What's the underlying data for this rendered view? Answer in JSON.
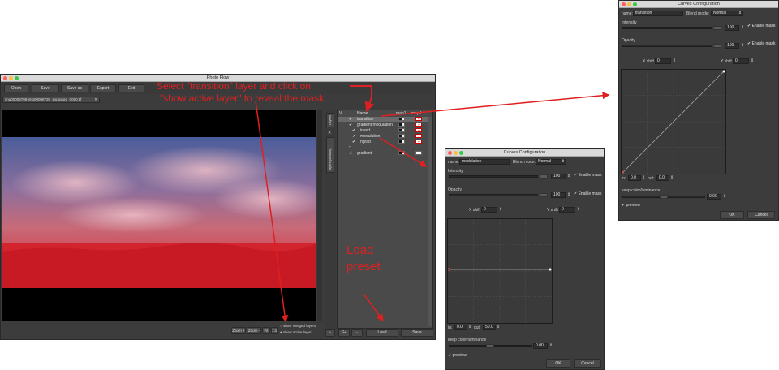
{
  "main_window": {
    "title": "Photo Flow",
    "toolbar": [
      "Open",
      "Save",
      "Save as",
      "Export",
      "Exit"
    ],
    "tab_filename": "img00008708-img00008720_exposure_0000.tif",
    "side_tabs": [
      "Layers",
      "layers (default)"
    ],
    "layers_header": {
      "v": "V",
      "name": "Name",
      "map1": "map1",
      "map2": "map2"
    },
    "layers": [
      "transition",
      "gradient modulation",
      "invert",
      "modulation",
      "hgrad",
      "",
      "gradient"
    ],
    "view_buttons": [
      "Zoom +",
      "Zoom -",
      "Fit",
      "1:1"
    ],
    "radio_options": [
      "show merged layers",
      "show active layer"
    ],
    "bottom_buttons": [
      "G+",
      "-",
      "Load",
      "Save"
    ]
  },
  "curves_small": {
    "title": "Curves Configuration",
    "name_label": "name:",
    "name_value": "modulation",
    "blend_label": "Blend mode:",
    "blend_value": "Normal",
    "intensity_label": "Intensity",
    "intensity_value": "100",
    "opacity_label": "Opacity",
    "opacity_value": "100",
    "enable_mask": "Enable mask",
    "xshift_label": "X shift",
    "xshift_value": "0",
    "yshift_label": "Y shift",
    "yshift_value": "0",
    "in_label": "in:",
    "in_value": "0.0",
    "out_label": "out:",
    "out_value": "50.0",
    "keep_label": "keep color/luminance",
    "keep_value": "0.00",
    "preview_label": "preview",
    "ok": "OK",
    "cancel": "Cancel"
  },
  "curves_big": {
    "title": "Curves Configuration",
    "name_label": "name:",
    "name_value": "transition",
    "blend_label": "Blend mode:",
    "blend_value": "Normal",
    "intensity_label": "Intensity",
    "intensity_value": "100",
    "opacity_label": "Opacity",
    "opacity_value": "100",
    "enable_mask": "Enable mask",
    "xshift_label": "X shift",
    "xshift_value": "0",
    "yshift_label": "Y shift",
    "yshift_value": "0",
    "in_label": "in:",
    "in_value": "0.0",
    "out_label": "out:",
    "out_value": "0.0",
    "keep_label": "keep color/luminance",
    "keep_value": "0.00",
    "preview_label": "preview",
    "ok": "OK",
    "cancel": "Cancel"
  },
  "annotations": {
    "instruction_line1": "Select \"transition\" layer and click on",
    "instruction_line2": "\"show active layer\" to reveal the mask",
    "load_line1": "Load",
    "load_line2": "preset"
  },
  "colors": {
    "annotation_red": "#e02020",
    "panel_bg": "#3c3c3c",
    "mask_red": "#d8202a"
  }
}
